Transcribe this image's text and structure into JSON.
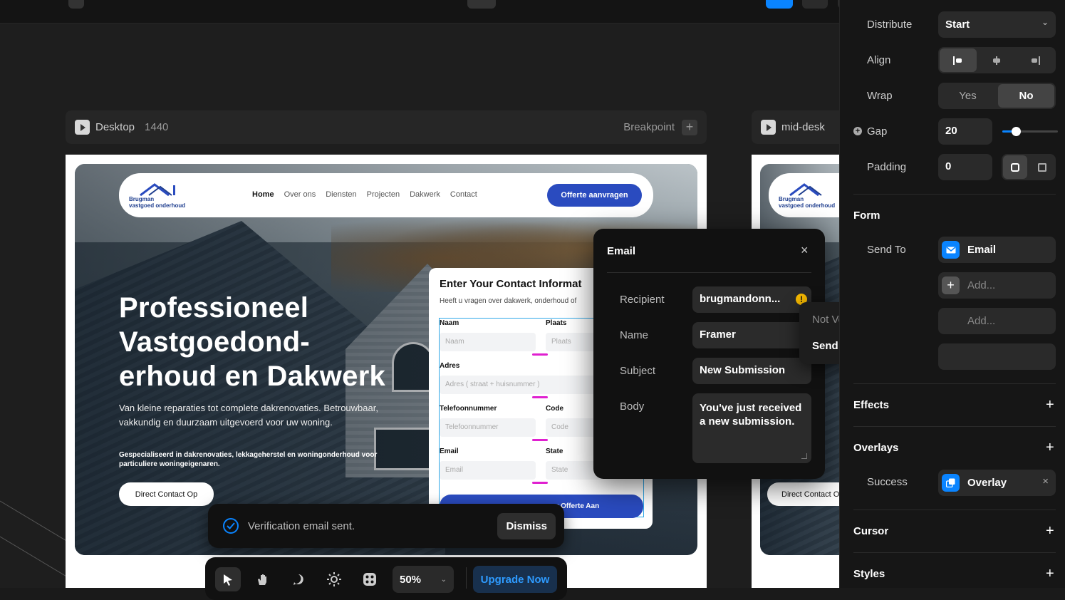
{
  "canvas": {
    "desktop_frame": {
      "label": "Desktop",
      "width": "1440",
      "breakpoint_label": "Breakpoint"
    },
    "mid_frame": {
      "label": "mid-desk"
    }
  },
  "site": {
    "logo_line1": "Brugman",
    "logo_line2": "vastgoed onderhoud",
    "nav": [
      "Home",
      "Over ons",
      "Diensten",
      "Projecten",
      "Dakwerk",
      "Contact"
    ],
    "cta": "Offerte aanvragen",
    "hero_title_1": "Professioneel",
    "hero_title_2": "Vastgoedond-",
    "hero_title_3": "erhoud en Dakwerk",
    "hero_text": "Van kleine reparaties tot complete dakrenovaties. Betrouwbaar, vakkundig en duurzaam uitgevoerd voor uw woning.",
    "hero_sub": "Gespecialiseerd in dakrenovaties, lekkageherstel en woningonderhoud voor particuliere woningeigenaren.",
    "hero_button": "Direct Contact Op",
    "form": {
      "title": "Enter Your Contact Informat",
      "subtitle": "Heeft u vragen over dakwerk, onderhoud of",
      "labels": [
        "Naam",
        "Plaats",
        "Adres",
        "Telefoonnummer",
        "Code",
        "Email",
        "State"
      ],
      "placeholders": [
        "Naam",
        "Plaats",
        "Adres ( straat + huisnummer )",
        "Telefoonnummer",
        "Code",
        "Email",
        "State"
      ],
      "submit": "v Offerte Aan"
    }
  },
  "email_popover": {
    "title": "Email",
    "fields": [
      {
        "label": "Recipient",
        "value": "brugmandonn..."
      },
      {
        "label": "Name",
        "value": "Framer"
      },
      {
        "label": "Subject",
        "value": "New Submission"
      },
      {
        "label": "Body",
        "value": "You've just received a new submission."
      }
    ]
  },
  "verify_menu": {
    "status": "Not Verified",
    "action": "Send Verification Email"
  },
  "toast": {
    "message": "Verification email sent.",
    "dismiss": "Dismiss"
  },
  "toolbar": {
    "zoom": "50%",
    "upgrade": "Upgrade Now"
  },
  "panel": {
    "distribute": {
      "label": "Distribute",
      "value": "Start"
    },
    "align_label": "Align",
    "wrap": {
      "label": "Wrap",
      "yes": "Yes",
      "no": "No"
    },
    "gap": {
      "label": "Gap",
      "value": "20",
      "slider_fraction": 0.25
    },
    "padding": {
      "label": "Padding",
      "value": "0"
    },
    "form_section": "Form",
    "send_to_label": "Send To",
    "send_to_items": [
      "Email",
      "Add...",
      "Add..."
    ],
    "effects": "Effects",
    "overlays": "Overlays",
    "success": {
      "label": "Success",
      "value": "Overlay"
    },
    "cursor": "Cursor",
    "styles": "Styles"
  },
  "colors": {
    "accent": "#0a84ff",
    "brand_blue": "#2a4bbf",
    "warning": "#f5b800",
    "magenta": "#e020d0"
  }
}
